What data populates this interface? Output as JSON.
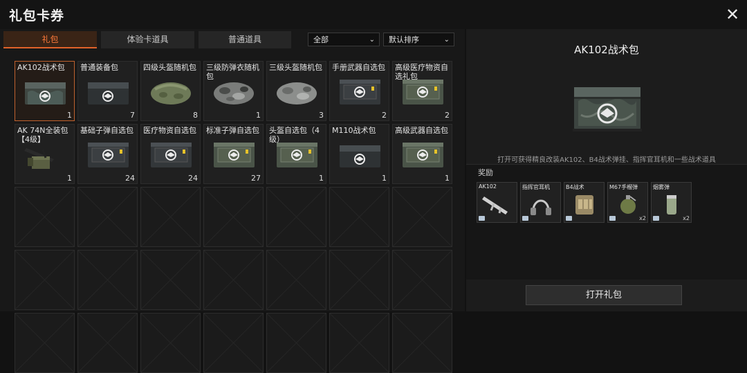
{
  "window": {
    "title": "礼包卡券",
    "close_icon": "close-icon"
  },
  "tabs": [
    {
      "label": "礼包",
      "active": true
    },
    {
      "label": "体验卡道具",
      "active": false
    },
    {
      "label": "普通道具",
      "active": false
    }
  ],
  "filters": {
    "category": "全部",
    "sort": "默认排序"
  },
  "items": [
    {
      "name": "AK102战术包",
      "qty": "1",
      "art": "crate-camo",
      "selected": true
    },
    {
      "name": "普通装备包",
      "qty": "7",
      "art": "crate-dark"
    },
    {
      "name": "四级头盔随机包",
      "qty": "8",
      "art": "bag-green"
    },
    {
      "name": "三级防弹衣随机包",
      "qty": "1",
      "art": "bag-camo"
    },
    {
      "name": "三级头盔随机包",
      "qty": "3",
      "art": "bag-grey"
    },
    {
      "name": "手册武器自选包",
      "qty": "2",
      "art": "case-dark"
    },
    {
      "name": "高级医疗物资自选礼包",
      "qty": "2",
      "art": "case-green"
    },
    {
      "name": "AK 74N全装包【4级】",
      "qty": "1",
      "art": "rifle-kit"
    },
    {
      "name": "基础子弹自选包",
      "qty": "24",
      "art": "case-dark"
    },
    {
      "name": "医疗物资自选包",
      "qty": "24",
      "art": "case-dark"
    },
    {
      "name": "标准子弹自选包",
      "qty": "27",
      "art": "case-green"
    },
    {
      "name": "头盔自选包（4级）",
      "qty": "1",
      "art": "case-green"
    },
    {
      "name": "M110战术包",
      "qty": "1",
      "art": "crate-dark"
    },
    {
      "name": "高级武器自选包",
      "qty": "1",
      "art": "case-green"
    }
  ],
  "empty_slots": 21,
  "detail": {
    "title": "AK102战术包",
    "description": "打开可获得精良改装AK102、B4战术弹挂、指挥官耳机和一些战术道具",
    "rewards_label": "奖励",
    "rewards": [
      {
        "name": "AK102",
        "qty": "",
        "art": "rifle"
      },
      {
        "name": "指挥官耳机",
        "qty": "",
        "art": "headset"
      },
      {
        "name": "B4战术",
        "qty": "",
        "art": "vest"
      },
      {
        "name": "M67手榴弹",
        "qty": "x2",
        "art": "grenade"
      },
      {
        "name": "烟雾弹",
        "qty": "x2",
        "art": "smoke"
      }
    ],
    "open_button": "打开礼包"
  },
  "colors": {
    "accent": "#e0622a",
    "background": "#121212"
  }
}
